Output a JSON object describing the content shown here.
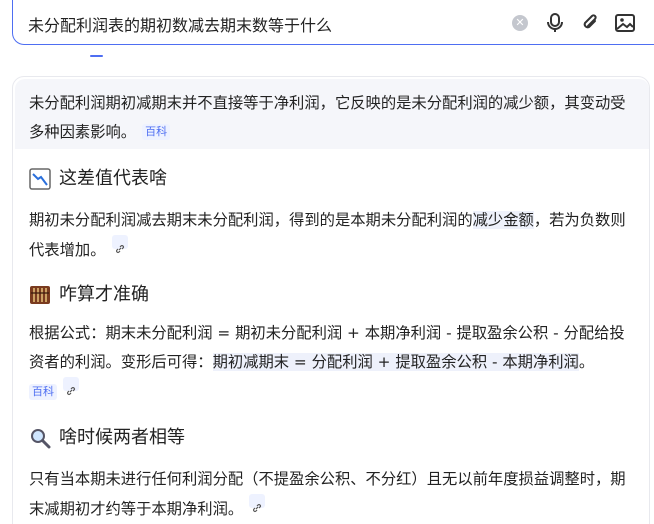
{
  "search": {
    "query": "未分配利润表的期初数减去期末数等于什么"
  },
  "answer": {
    "summary_text": "未分配利润期初减期末并不直接等于净利润，它反映的是未分配利润的减少额，其变动受多种因素影响。",
    "summary_tag": "百科",
    "sections": [
      {
        "icon": "chart-down-icon",
        "title": "这差值代表啥",
        "text_plain": "期初未分配利润减去期末未分配利润，得到的是本期未分配利润的",
        "text_highlight": "减少金额",
        "text_after": "，若为负数则代表增加。"
      },
      {
        "icon": "abacus-icon",
        "title": "咋算才准确",
        "text_plain": "根据公式：期末未分配利润 = 期初未分配利润 + 本期净利润 - 提取盈余公积 - 分配给投资者的利润。变形后可得：",
        "text_highlight": "期初减期末 = 分配利润 + 提取盈余公积 - 本期净利润",
        "text_after": "。",
        "tag": "百科"
      },
      {
        "icon": "magnifier-icon",
        "title": "啥时候两者相等",
        "text_plain": "只有当本期未进行任何利润分配（不提盈余公积、不分红）且无以前年度损益调整时，期末减期初才约等于本期净利润。"
      }
    ]
  },
  "colors": {
    "accent": "#4e6ef2",
    "summary_bg": "#f5f6fa",
    "tag_bg": "#eef2ff"
  }
}
